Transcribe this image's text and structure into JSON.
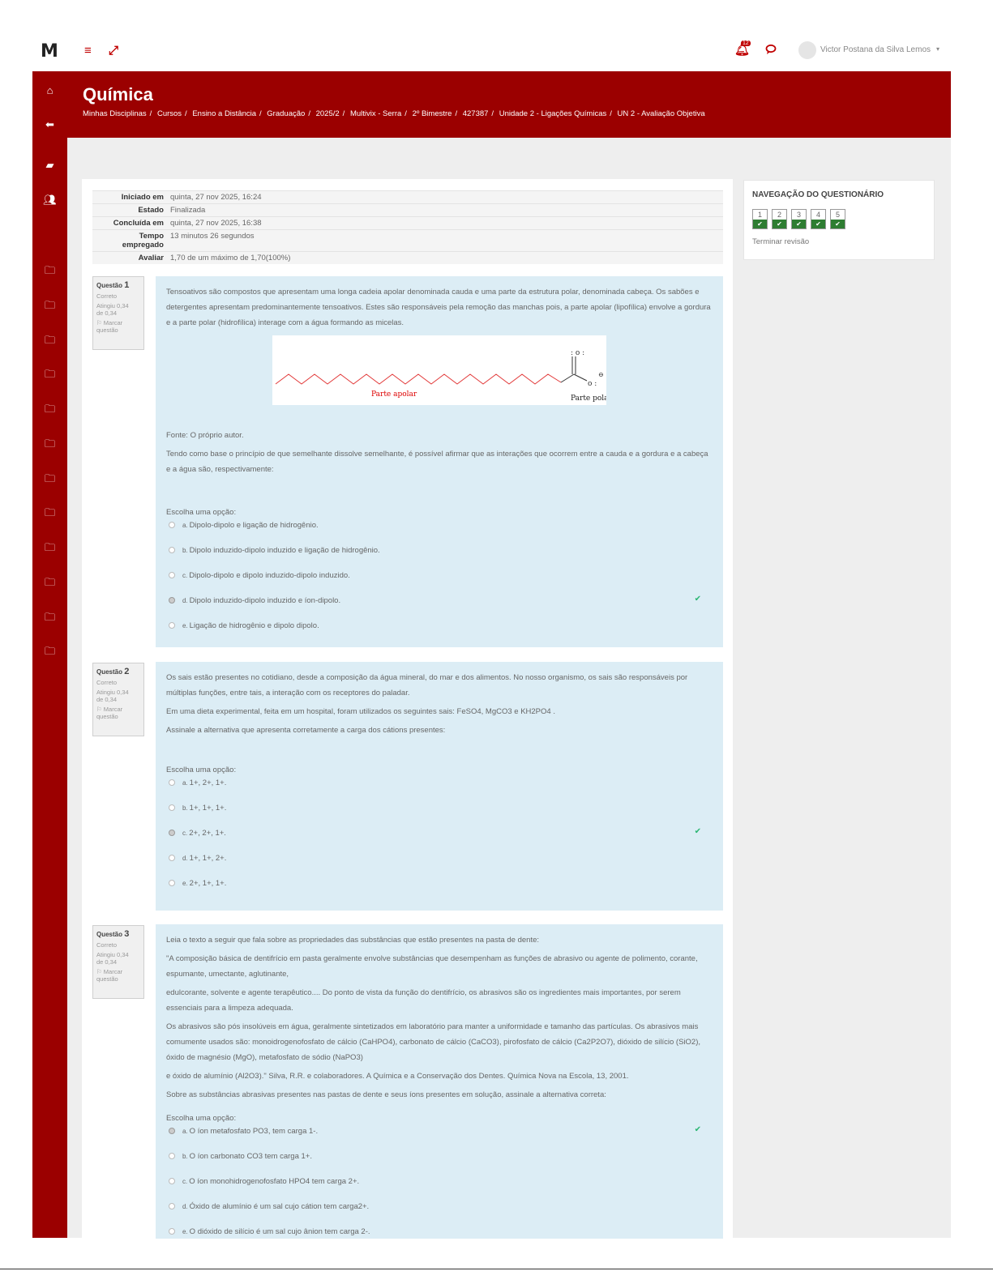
{
  "topbar": {
    "logo": "M",
    "menu_icon": "menu-icon",
    "expand_icon": "expand-icon",
    "notification_icon": "bell-icon",
    "notification_badge": "12",
    "chat_icon": "chat-icon",
    "user_name": "Victor Postana da Silva Lemos",
    "caret": "▾"
  },
  "sidebar": {
    "icons": [
      "home-icon",
      "arrow-left-icon",
      "book-icon",
      "users-icon",
      "folder-icon",
      "folder-icon",
      "folder-icon",
      "folder-icon",
      "folder-icon",
      "folder-icon",
      "folder-icon",
      "folder-icon",
      "folder-icon",
      "folder-icon",
      "folder-icon",
      "folder-icon"
    ]
  },
  "header": {
    "title": "Química",
    "breadcrumb": [
      "Minhas Disciplinas",
      "/",
      "Cursos",
      "/",
      "Ensino a Distância",
      "/",
      "Graduação",
      "/",
      "2025/2",
      "/",
      "Multivix - Serra",
      "/",
      "2º Bimestre",
      "/",
      "427387",
      "/",
      "Unidade 2 - Ligações Químicas",
      "/",
      "UN 2 - Avaliação Objetiva"
    ]
  },
  "summary": {
    "started_label": "Iniciado em",
    "started_value": "quinta, 27 nov 2025, 16:24",
    "state_label": "Estado",
    "state_value": "Finalizada",
    "completed_label": "Concluída em",
    "completed_value": "quinta, 27 nov 2025, 16:38",
    "time_label_1": "Tempo",
    "time_label_2": "empregado",
    "time_value": "13 minutos 26 segundos",
    "grade_label": "Avaliar",
    "grade_value": "1,70 de um máximo de 1,70(100%)"
  },
  "q1": {
    "label": "Questão",
    "number": "1",
    "status": "Correto",
    "grade_1": "Atingiu 0,34",
    "grade_2": "de 0,34",
    "flag_1": "⚐ Marcar",
    "flag_2": "questão",
    "text_1": "Tensoativos são compostos que apresentam uma longa cadeia apolar denominada cauda e uma parte da estrutura polar, denominada cabeça. Os sabões e detergentes apresentam predominantemente tensoativos. Estes são responsáveis pela remoção das manchas pois, a parte apolar (lipofílica) envolve a gordura e a parte polar (hidrofílica) interage com a água formando as micelas.",
    "img_label_apolar": "Parte apolar",
    "img_label_polar": "Parte polar",
    "source": "Fonte: O próprio autor.",
    "text_2": "Tendo como base o princípio de que semelhante dissolve semelhante, é possível afirmar que as interações que ocorrem entre a cauda e a gordura e a cabeça e a água são, respectivamente:",
    "prompt": "Escolha uma opção:",
    "options": [
      {
        "letter": "a.",
        "text": "Dipolo-dipolo e ligação de hidrogênio."
      },
      {
        "letter": "b.",
        "text": "Dipolo induzido-dipolo induzido e ligação de hidrogênio."
      },
      {
        "letter": "c.",
        "text": "Dipolo-dipolo e dipolo induzido-dipolo induzido."
      },
      {
        "letter": "d.",
        "text": "Dipolo induzido-dipolo induzido e íon-dipolo."
      },
      {
        "letter": "e.",
        "text": "Ligação de hidrogênio e dipolo dipolo."
      }
    ],
    "selected": 3
  },
  "q2": {
    "label": "Questão",
    "number": "2",
    "status": "Correto",
    "grade_1": "Atingiu 0,34",
    "grade_2": "de 0,34",
    "flag_1": "⚐ Marcar",
    "flag_2": "questão",
    "text_1": "Os sais estão presentes no cotidiano, desde a composição da água mineral, do mar e dos alimentos. No nosso organismo, os sais são responsáveis por múltiplas funções, entre tais, a interação com os receptores do paladar.",
    "text_2": "Em uma dieta experimental, feita em um hospital, foram utilizados os seguintes sais: FeSO4, MgCO3 e  KH2PO4 .",
    "text_3": "Assinale a alternativa que apresenta corretamente a carga dos cátions presentes:",
    "prompt": "Escolha uma opção:",
    "options": [
      {
        "letter": "a.",
        "text": "1+, 2+, 1+."
      },
      {
        "letter": "b.",
        "text": "1+, 1+, 1+."
      },
      {
        "letter": "c.",
        "text": "2+, 2+, 1+."
      },
      {
        "letter": "d.",
        "text": "1+, 1+, 2+."
      },
      {
        "letter": "e.",
        "text": "2+, 1+, 1+."
      }
    ],
    "selected": 2
  },
  "q3": {
    "label": "Questão",
    "number": "3",
    "status": "Correto",
    "grade_1": "Atingiu 0,34",
    "grade_2": "de 0,34",
    "flag_1": "⚐ Marcar",
    "flag_2": "questão",
    "text_1": "Leia o texto a seguir que fala sobre as propriedades das  substâncias que estão presentes na pasta de dente:",
    "text_2": "\"A composição básica de dentifrício em pasta geralmente envolve substâncias que desempenham as funções de abrasivo ou agente de polimento, corante, espumante, umectante, aglutinante,",
    "text_3": "edulcorante, solvente e agente terapêutico.... Do ponto de vista da função do dentifrício, os abrasivos são os ingredientes mais importantes, por serem essenciais para a limpeza adequada.",
    "text_4": "Os abrasivos são pós insolúveis em água, geralmente sintetizados em laboratório para manter a uniformidade e tamanho das partículas. Os abrasivos mais comumente usados são: monoidrogenofosfato de cálcio (CaHPO4), carbonato de cálcio (CaCO3), pirofosfato de cálcio (Ca2P2O7), dióxido de silício (SiO2), óxido de magnésio (MgO), metafosfato de sódio (NaPO3)",
    "text_5": "e óxido de alumínio (Al2O3).\" Silva, R.R. e colaboradores. A Química e a Conservação dos Dentes. Química Nova na Escola, 13, 2001.",
    "text_6": "Sobre as substâncias abrasivas presentes nas pastas de dente e seus íons presentes em solução, assinale a alternativa correta:",
    "prompt": "Escolha uma opção:",
    "options": [
      {
        "letter": "a.",
        "text": "O íon metafosfato PO3, tem carga 1-."
      },
      {
        "letter": "b.",
        "text": "O íon carbonato  CO3 tem carga  1+."
      },
      {
        "letter": "c.",
        "text": "O íon monohidrogenofosfato HPO4 tem carga 2+."
      },
      {
        "letter": "d.",
        "text": "Óxido de alumínio é um sal cujo cátion tem carga2+."
      },
      {
        "letter": "e.",
        "text": "O dióxido de silício é um sal cujo ânion tem carga 2-."
      }
    ],
    "selected": 0
  },
  "quiz_nav": {
    "title": "NAVEGAÇÃO DO QUESTIONÁRIO",
    "buttons": [
      "1",
      "2",
      "3",
      "4",
      "5"
    ],
    "check": "✔",
    "finish": "Terminar revisão"
  },
  "colors": {
    "brand": "#9b0000",
    "question_bg": "#dcedf5",
    "correct": "#2e7d32",
    "check": "#2bb673"
  }
}
